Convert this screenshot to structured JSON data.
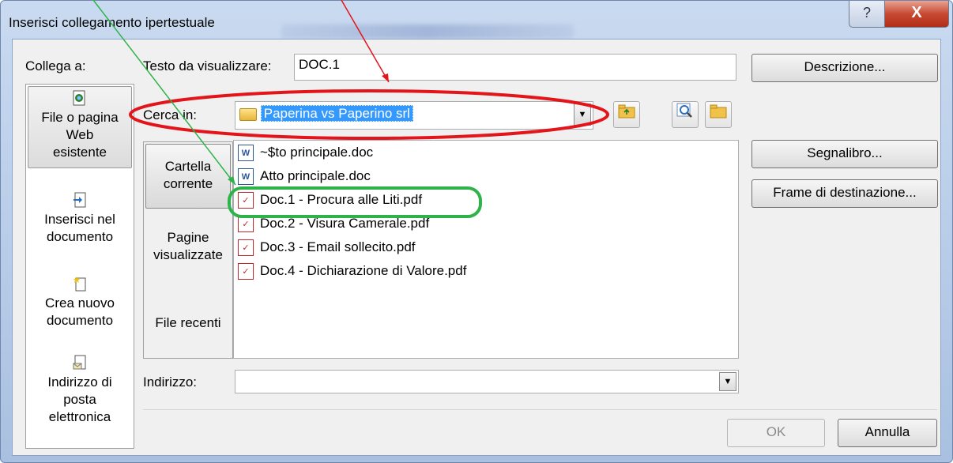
{
  "window": {
    "title": "Inserisci collegamento ipertestuale",
    "help_glyph": "?",
    "close_glyph": "X"
  },
  "link_to": {
    "label_pre": "",
    "label_u": "C",
    "label_post": "ollega a:",
    "full_label": "Collega a:",
    "items": [
      {
        "line1": "File o pagina",
        "line2": "Web",
        "line3": "esistente",
        "icon": "existing-file-icon"
      },
      {
        "line1": "Inserisci nel",
        "line2": "documento",
        "icon": "place-in-document-icon"
      },
      {
        "line1": "Crea nuovo",
        "line2": "documento",
        "icon": "create-new-document-icon"
      },
      {
        "line1": "Indirizzo di",
        "line2": "posta",
        "line3": "elettronica",
        "icon": "email-address-icon"
      }
    ]
  },
  "text_to_display": {
    "label": "Testo da visualizzare:",
    "value": "DOC.1"
  },
  "look_in": {
    "label": "Cerca in:",
    "value": "Paperina vs Paperino srl"
  },
  "views": {
    "current_folder": {
      "line1": "Cartella",
      "line2": "corrente"
    },
    "browsed_pages": {
      "line1": "Pagine",
      "line2": "visualizzate"
    },
    "recent_files": "File recenti"
  },
  "files": [
    {
      "name": "~$to principale.doc",
      "type": "word"
    },
    {
      "name": "Atto principale.doc",
      "type": "word"
    },
    {
      "name": "Doc.1 - Procura alle Liti.pdf",
      "type": "pdf"
    },
    {
      "name": "Doc.2 - Visura Camerale.pdf",
      "type": "pdf"
    },
    {
      "name": "Doc.3 - Email sollecito.pdf",
      "type": "pdf"
    },
    {
      "name": "Doc.4 - Dichiarazione di Valore.pdf",
      "type": "pdf"
    }
  ],
  "address": {
    "label": "Indirizzo:",
    "value": ""
  },
  "buttons": {
    "screentip": "Descrizione...",
    "bookmark": "Segnalibro...",
    "target_frame": "Frame di destinazione...",
    "ok": "OK",
    "cancel": "Annulla"
  },
  "annotation_colors": {
    "red": "#e3151b",
    "green": "#2db34a"
  }
}
